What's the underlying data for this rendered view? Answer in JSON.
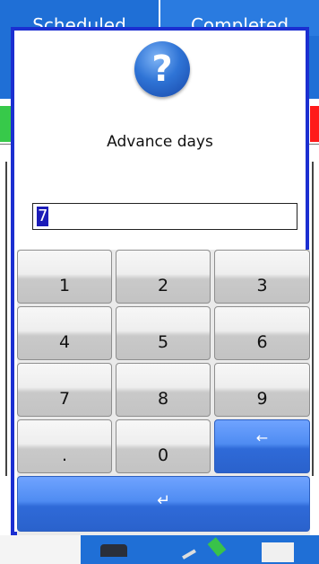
{
  "background": {
    "tabs": [
      "Scheduled",
      "Completed"
    ]
  },
  "dialog": {
    "icon": "question-help-icon",
    "prompt": "Advance days",
    "input_value": "7",
    "keys": [
      "1",
      "2",
      "3",
      "4",
      "5",
      "6",
      "7",
      "8",
      "9",
      ".",
      "0"
    ],
    "backspace_glyph": "←",
    "enter_glyph": "↵"
  },
  "colors": {
    "dialog_border": "#1b2fd1",
    "accent_blue": "#1f6fd6",
    "key_blue": "#4f8cf2"
  }
}
